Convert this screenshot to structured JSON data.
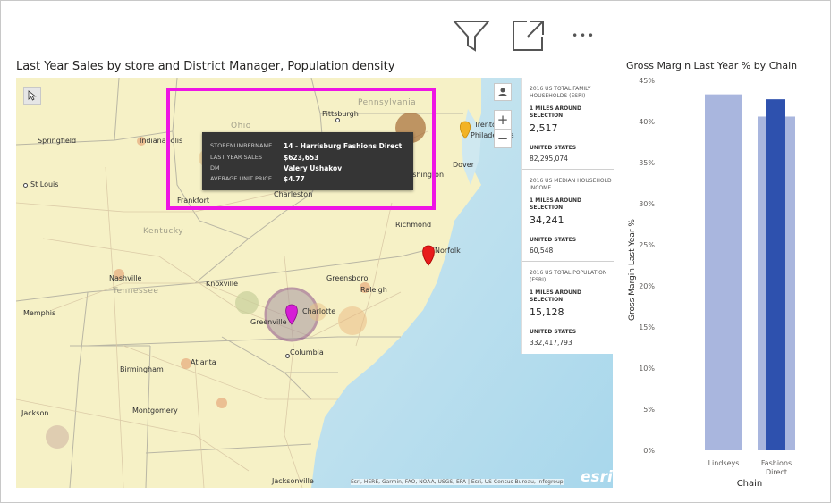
{
  "toolbar": {
    "filter_icon": "filter-icon",
    "focus_icon": "focus-mode-icon",
    "more_icon": "more-options-icon",
    "more_label": "• • •"
  },
  "map_visual": {
    "title": "Last Year Sales by store and District Manager, Population density",
    "tooltip": {
      "rows": [
        {
          "key": "STORENUMBERNAME",
          "value": "14 - Harrisburg Fashions Direct"
        },
        {
          "key": "LAST YEAR SALES",
          "value": "$623,653"
        },
        {
          "key": "DM",
          "value": "Valery Ushakov"
        },
        {
          "key": "AVERAGE UNIT PRICE",
          "value": "$4.77"
        }
      ]
    },
    "controls": {
      "zoom_in": "+",
      "zoom_out": "−"
    },
    "places": [
      {
        "name": "Pennsylvania"
      },
      {
        "name": "Pittsburgh"
      },
      {
        "name": "Ohio"
      },
      {
        "name": "Springfield"
      },
      {
        "name": "Indianapolis"
      },
      {
        "name": "St Louis"
      },
      {
        "name": "Frankfort"
      },
      {
        "name": "Charleston"
      },
      {
        "name": "Richmond"
      },
      {
        "name": "Kentucky"
      },
      {
        "name": "Nashville"
      },
      {
        "name": "Knoxville"
      },
      {
        "name": "Tennessee"
      },
      {
        "name": "Greensboro"
      },
      {
        "name": "Raleigh"
      },
      {
        "name": "Memphis"
      },
      {
        "name": "Charlotte"
      },
      {
        "name": "Greenville"
      },
      {
        "name": "Columbia"
      },
      {
        "name": "Atlanta"
      },
      {
        "name": "Birmingham"
      },
      {
        "name": "Montgomery"
      },
      {
        "name": "Jackson"
      },
      {
        "name": "Jacksonville"
      },
      {
        "name": "Norfolk"
      },
      {
        "name": "Dover"
      },
      {
        "name": "Trenton"
      },
      {
        "name": "Philadelphia"
      },
      {
        "name": "Washington"
      }
    ],
    "panel": [
      {
        "heading": "2016 US TOTAL FAMILY HOUSEHOLDS (ESRI)",
        "selection": "1 MILES AROUND SELECTION",
        "value": "2,517",
        "region": "UNITED STATES",
        "total": "82,295,074"
      },
      {
        "heading": "2016 US MEDIAN HOUSEHOLD INCOME",
        "selection": "1 MILES AROUND SELECTION",
        "value": "34,241",
        "region": "UNITED STATES",
        "total": "60,548"
      },
      {
        "heading": "2016 US TOTAL POPULATION (ESRI)",
        "selection": "1 MILES AROUND SELECTION",
        "value": "15,128",
        "region": "UNITED STATES",
        "total": "332,417,793"
      }
    ],
    "attribution": "Esri, HERE, Garmin, FAO, NOAA, USGS, EPA | Esri, US Census Bureau, Infogroup",
    "esri_logo": "esri",
    "pin_colors": {
      "yellow": "#f2b325",
      "red": "#e81c1c",
      "magenta": "#d61ed6"
    }
  },
  "chart_data": {
    "type": "bar",
    "title": "Gross Margin Last Year % by Chain",
    "xlabel": "Chain",
    "ylabel": "Gross Margin Last Year %",
    "categories": [
      "Lindseys",
      "Fashions Direct"
    ],
    "category_lines": [
      [
        "Lindseys"
      ],
      [
        "Fashions",
        "Direct"
      ]
    ],
    "y_ticks": [
      "0%",
      "5%",
      "10%",
      "15%",
      "20%",
      "25%",
      "30%",
      "35%",
      "40%",
      "45%"
    ],
    "ylim": [
      0,
      45
    ],
    "series": [
      {
        "values": [
          43.3,
          40.6
        ],
        "color": "#a9b6de"
      },
      {
        "values": [
          null,
          42.7
        ],
        "color": "#2e51ae"
      }
    ]
  }
}
